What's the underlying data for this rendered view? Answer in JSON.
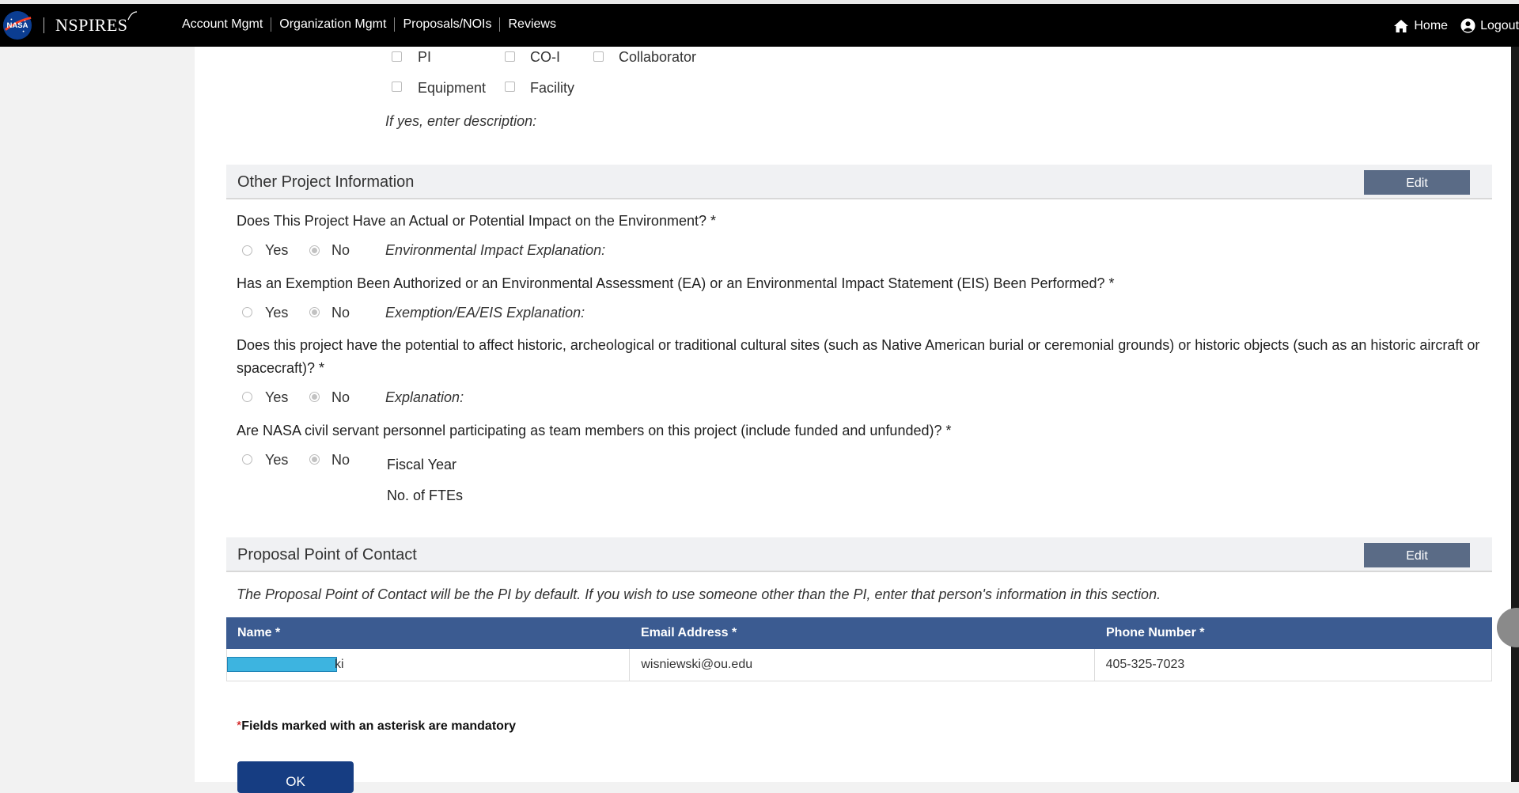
{
  "header": {
    "brand": "NSPIRES",
    "logo_text": "NASA",
    "nav": [
      "Account Mgmt",
      "Organization Mgmt",
      "Proposals/NOIs",
      "Reviews"
    ],
    "home": "Home",
    "logout": "Logout"
  },
  "roles": {
    "row1": [
      "PI",
      "CO-I",
      "Collaborator"
    ],
    "row2": [
      "Equipment",
      "Facility"
    ],
    "desc_label": "If yes, enter description:"
  },
  "other_project": {
    "title": "Other Project Information",
    "edit": "Edit",
    "q1": {
      "text": "Does This Project Have an Actual or Potential Impact on the Environment? *",
      "yes": "Yes",
      "no": "No",
      "explain": "Environmental Impact Explanation:",
      "selected": "No"
    },
    "q2": {
      "text": "Has an Exemption Been Authorized or an Environmental Assessment (EA) or an Environmental Impact Statement (EIS) Been Performed? *",
      "yes": "Yes",
      "no": "No",
      "explain": "Exemption/EA/EIS Explanation:",
      "selected": "No"
    },
    "q3": {
      "text": "Does this project have the potential to affect historic, archeological or traditional cultural sites (such as Native American burial or ceremonial grounds) or historic objects (such as an historic aircraft or spacecraft)? *",
      "yes": "Yes",
      "no": "No",
      "explain": "Explanation:",
      "selected": "No"
    },
    "q4": {
      "text": "Are NASA civil servant personnel participating as team members on this project (include funded and unfunded)? *",
      "yes": "Yes",
      "no": "No",
      "fiscal_year": "Fiscal Year",
      "ftes": "No. of FTEs",
      "selected": "No"
    }
  },
  "poc": {
    "title": "Proposal Point of Contact",
    "edit": "Edit",
    "note": "The Proposal Point of Contact will be the PI by default. If you wish to use someone other than the PI, enter that person's information in this section.",
    "columns": [
      "Name *",
      "Email Address *",
      "Phone Number *"
    ],
    "row": {
      "name_visible": "ki",
      "email": "wisniewski@ou.edu",
      "phone": "405-325-7023"
    }
  },
  "footer": {
    "mandatory_star": "*",
    "mandatory": "Fields marked with an asterisk are mandatory",
    "ok": "OK"
  },
  "colors": {
    "header_bg": "#000000",
    "table_header": "#3b5b91",
    "edit_button": "#5a6b86",
    "ok_button": "#163d82"
  }
}
